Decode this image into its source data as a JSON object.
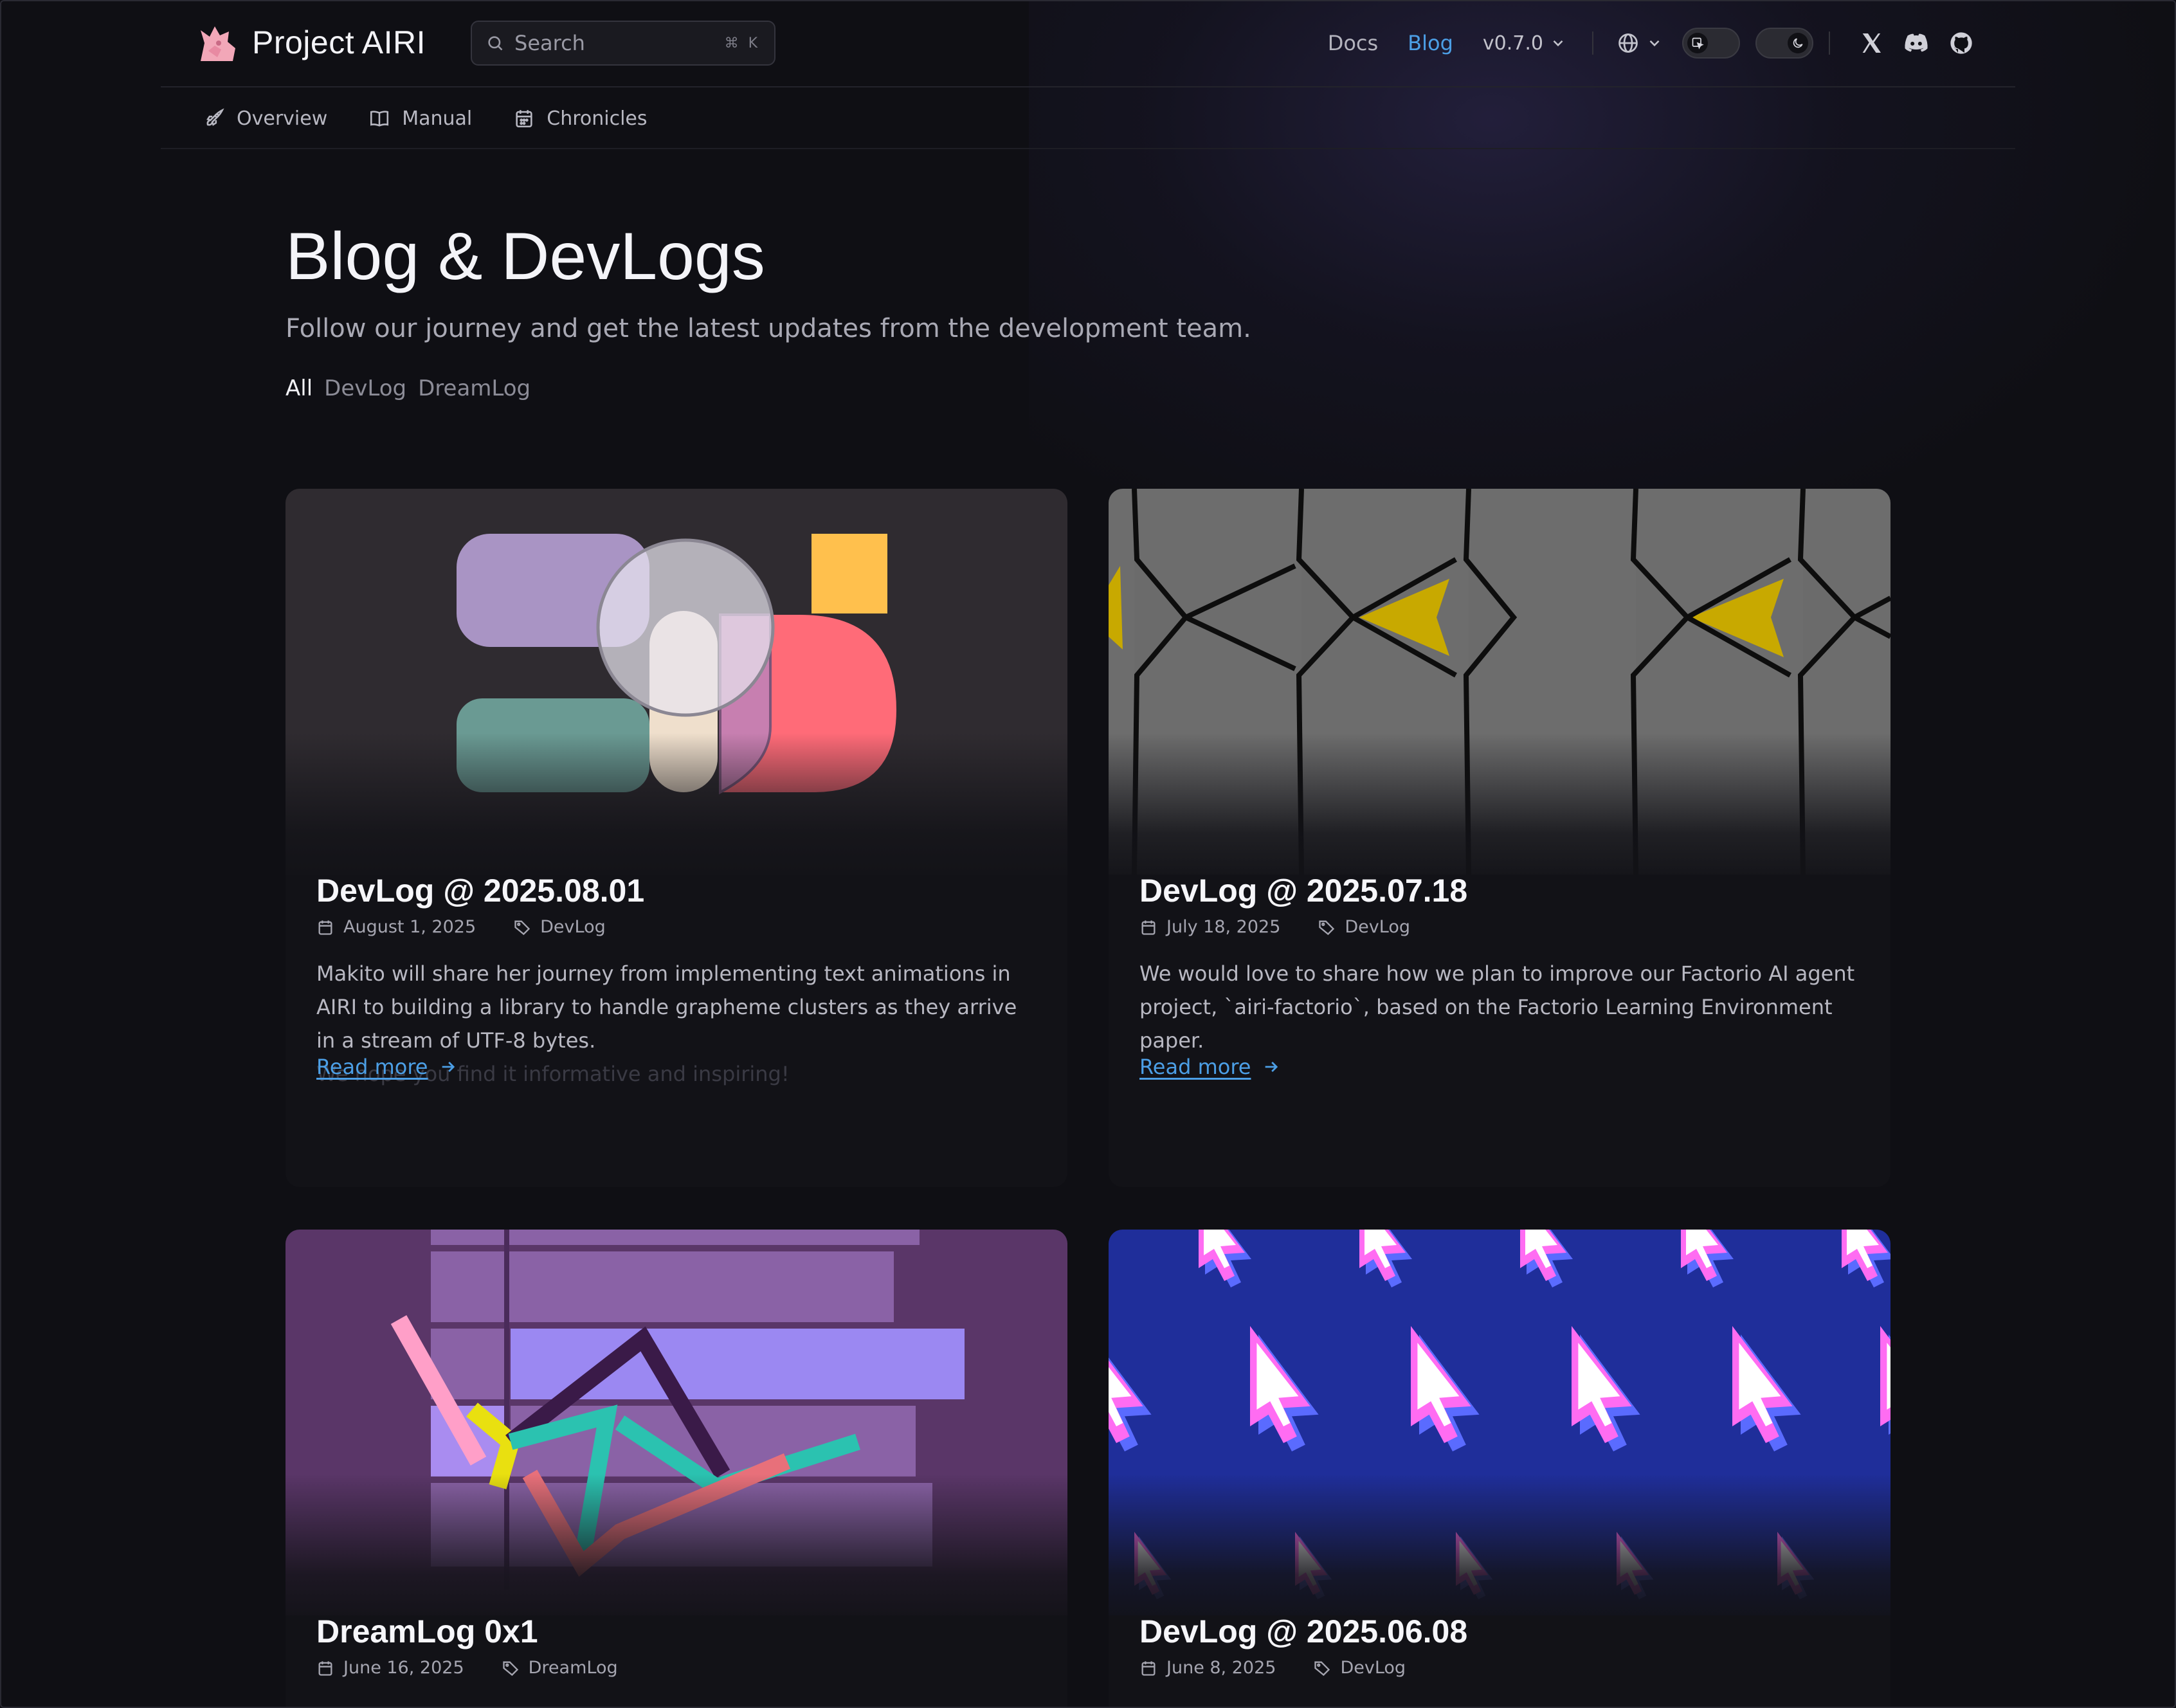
{
  "brand": {
    "name": "Project AIRI"
  },
  "search": {
    "placeholder": "Search",
    "shortcut": "⌘ K"
  },
  "nav": {
    "links": [
      {
        "label": "Docs",
        "active": false
      },
      {
        "label": "Blog",
        "active": true
      }
    ],
    "version": "v0.7.0"
  },
  "subnav": {
    "items": [
      {
        "label": "Overview",
        "icon": "rocket-icon"
      },
      {
        "label": "Manual",
        "icon": "book-icon"
      },
      {
        "label": "Chronicles",
        "icon": "calendar-icon"
      }
    ]
  },
  "hero": {
    "title": "Blog & DevLogs",
    "subtitle": "Follow our journey and get the latest updates from the development team.",
    "filters": [
      {
        "label": "All",
        "active": true
      },
      {
        "label": "DevLog",
        "active": false
      },
      {
        "label": "DreamLog",
        "active": false
      }
    ]
  },
  "posts": [
    {
      "title": "DevLog @ 2025.08.01",
      "date": "August 1, 2025",
      "tag": "DevLog",
      "excerpt": "Makito will share her journey from implementing text animations in AIRI to building a library to handle grapheme clusters as they arrive in a stream of UTF-8 bytes.",
      "excerpt_fade": "We hope you find it informative and inspiring!",
      "read_more": "Read more"
    },
    {
      "title": "DevLog @ 2025.07.18",
      "date": "July 18, 2025",
      "tag": "DevLog",
      "excerpt": "We would love to share how we plan to improve our Factorio AI agent project, `airi-factorio`, based on the Factorio Learning Environment paper.",
      "read_more": "Read more"
    },
    {
      "title": "DreamLog 0x1",
      "date": "June 16, 2025",
      "tag": "DreamLog"
    },
    {
      "title": "DevLog @ 2025.06.08",
      "date": "June 8, 2025",
      "tag": "DevLog"
    }
  ],
  "colors": {
    "accent": "#4c9fe6",
    "background": "#0f0f14",
    "card": "#121217"
  }
}
